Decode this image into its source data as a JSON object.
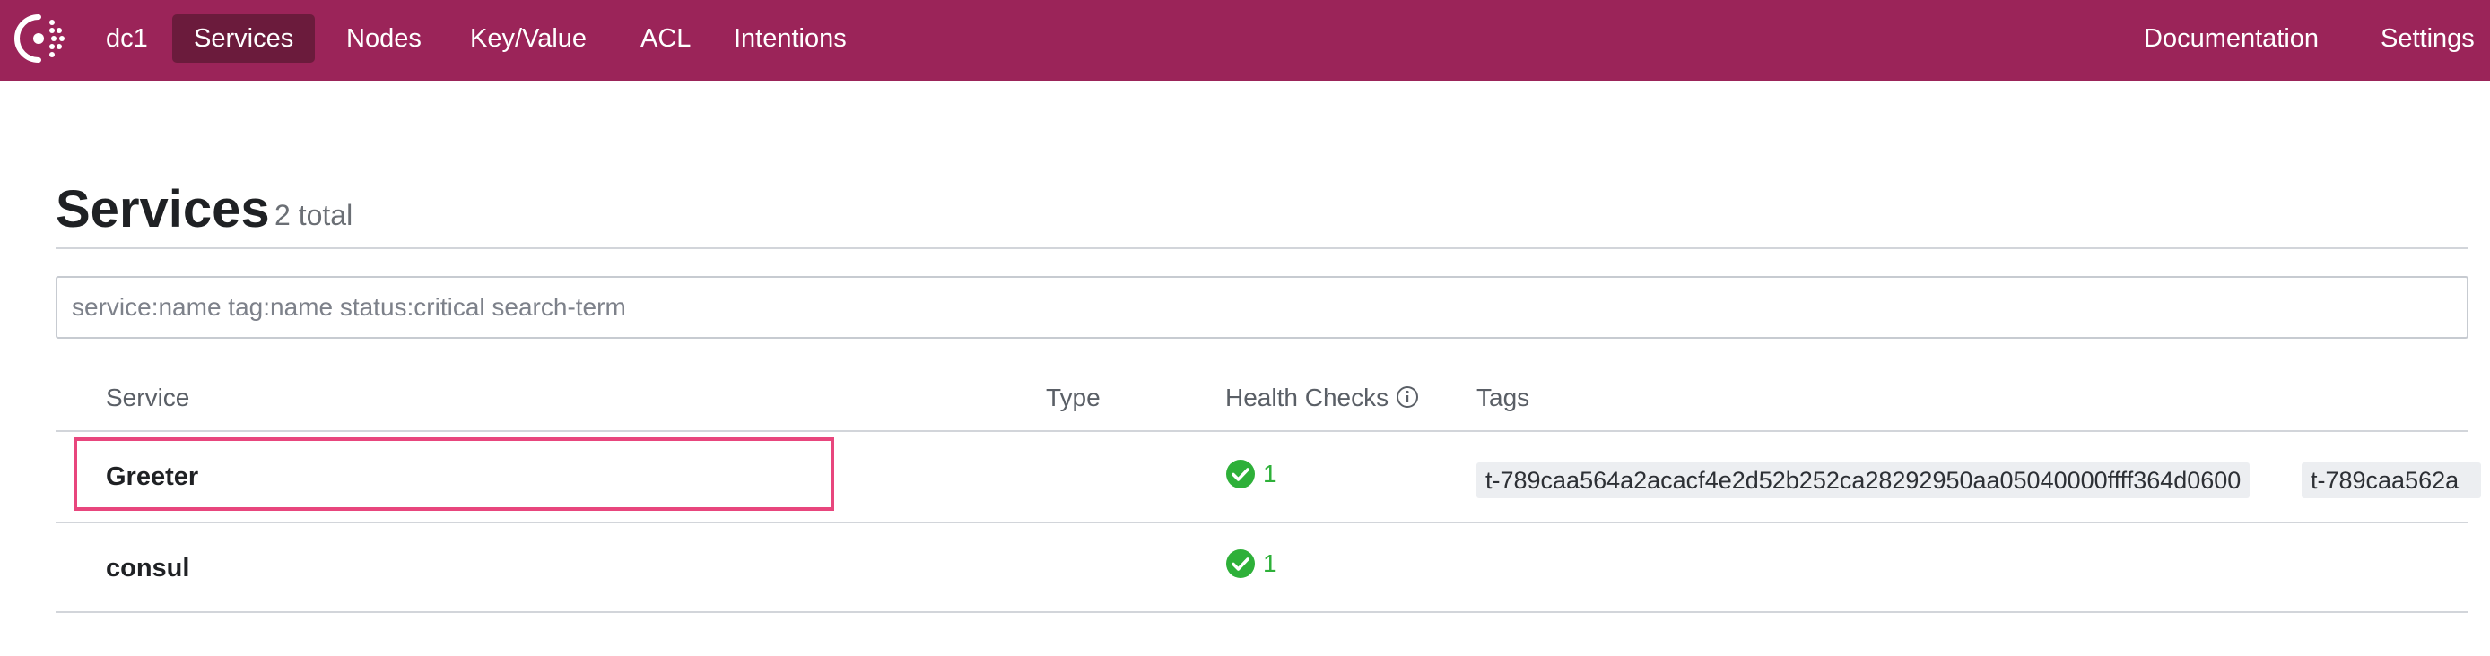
{
  "nav": {
    "logo": "consul-logo-icon",
    "datacenter": "dc1",
    "items": [
      {
        "label": "Services",
        "active": true
      },
      {
        "label": "Nodes",
        "active": false
      },
      {
        "label": "Key/Value",
        "active": false
      },
      {
        "label": "ACL",
        "active": false
      },
      {
        "label": "Intentions",
        "active": false
      }
    ],
    "right_items": [
      {
        "label": "Documentation"
      },
      {
        "label": "Settings"
      }
    ]
  },
  "page": {
    "title": "Services",
    "count": "2 total"
  },
  "search": {
    "value": "",
    "placeholder": "service:name tag:name status:critical search-term"
  },
  "table": {
    "headers": {
      "service": "Service",
      "type": "Type",
      "health": "Health Checks",
      "tags": "Tags"
    },
    "rows": [
      {
        "service": "Greeter",
        "type": "",
        "health_passing": "1",
        "tags": [
          "t-789caa564a2acacf4e2d52b252ca28292950aa05040000ffff364d0600",
          "t-789caa562a"
        ],
        "highlighted": true
      },
      {
        "service": "consul",
        "type": "",
        "health_passing": "1",
        "tags": [],
        "highlighted": false
      }
    ]
  },
  "colors": {
    "brand": "#9b2459",
    "brand_active": "#6b1b3c",
    "passing": "#2eb039",
    "highlight": "#e8467d"
  }
}
